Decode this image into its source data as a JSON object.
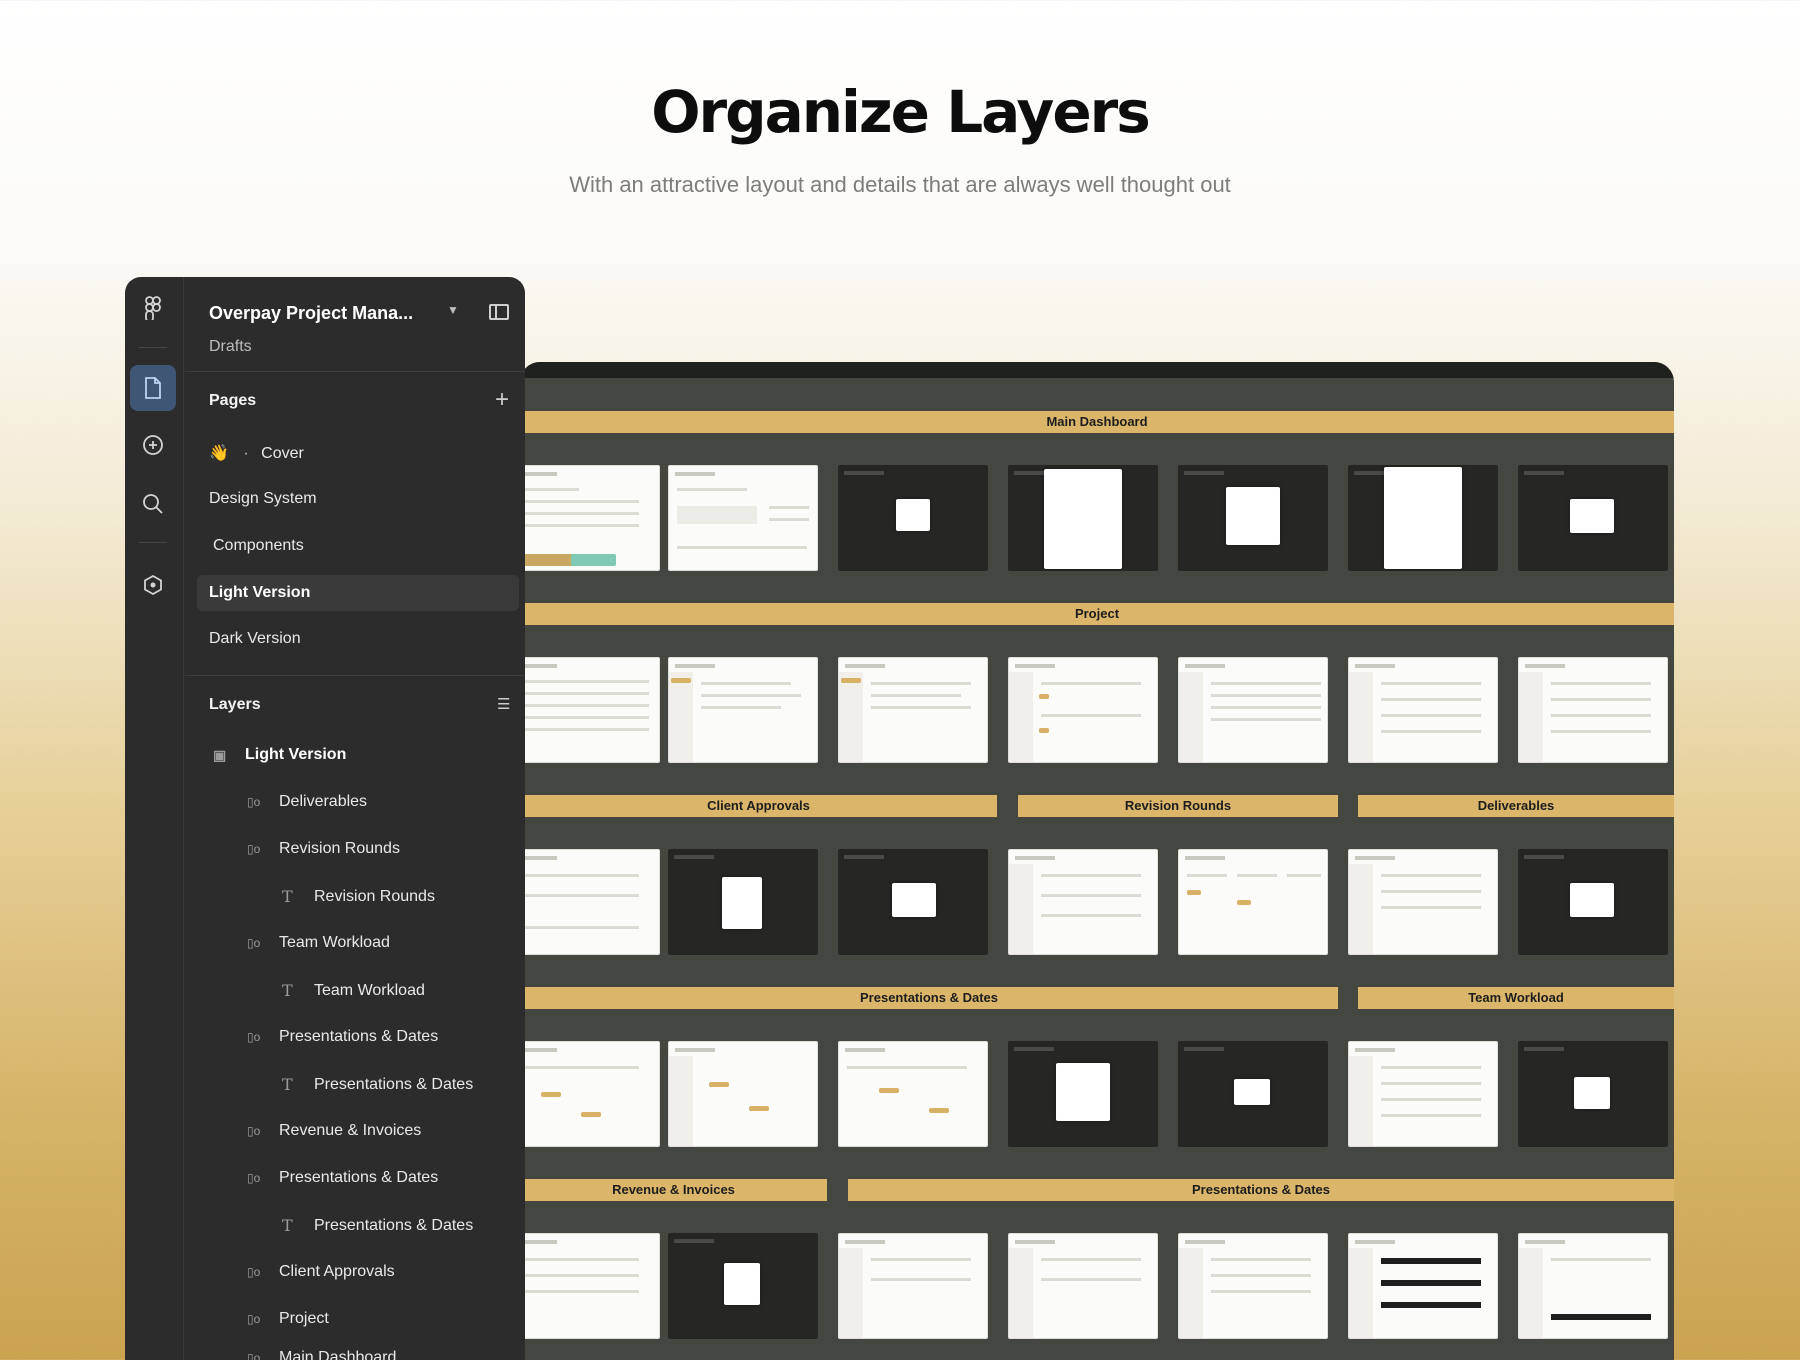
{
  "hero": {
    "title": "Organize Layers",
    "subtitle": "With an attractive layout and details that are always well thought out"
  },
  "rail": {
    "icons": [
      "figma-logo-icon",
      "pages-icon",
      "assets-icon",
      "search-icon",
      "plugins-icon"
    ]
  },
  "file": {
    "title": "Overpay Project Mana...",
    "location": "Drafts"
  },
  "pages": {
    "heading": "Pages",
    "items": [
      {
        "emoji": "👋",
        "label": "Cover"
      },
      {
        "label": "Design System"
      },
      {
        "label": "Components"
      },
      {
        "label": "Light Version"
      },
      {
        "label": "Dark Version"
      }
    ]
  },
  "layers": {
    "heading": "Layers",
    "items": [
      {
        "type": "page",
        "label": "Light Version"
      },
      {
        "type": "frame",
        "label": "Deliverables"
      },
      {
        "type": "frame",
        "label": "Revision Rounds"
      },
      {
        "type": "text",
        "label": "Revision Rounds"
      },
      {
        "type": "frame",
        "label": "Team Workload"
      },
      {
        "type": "text",
        "label": "Team Workload"
      },
      {
        "type": "frame",
        "label": "Presentations & Dates"
      },
      {
        "type": "text",
        "label": "Presentations & Dates"
      },
      {
        "type": "frame",
        "label": "Revenue & Invoices"
      },
      {
        "type": "frame",
        "label": "Presentations & Dates"
      },
      {
        "type": "text",
        "label": "Presentations & Dates"
      },
      {
        "type": "frame",
        "label": "Client Approvals"
      },
      {
        "type": "frame",
        "label": "Project"
      },
      {
        "type": "frame",
        "label": "Main Dashboard"
      }
    ]
  },
  "canvas": {
    "sections": [
      "Main Dashboard",
      "Project",
      "Client Approvals",
      "Revision Rounds",
      "Deliverables",
      "Presentations & Dates",
      "Team Workload",
      "Revenue & Invoices",
      "Presentations & Dates"
    ]
  },
  "colors": {
    "accent": "#dbb56a",
    "canvas": "#44473f",
    "panel": "#2c2c2c",
    "selected_page": "#3a3a3a"
  }
}
